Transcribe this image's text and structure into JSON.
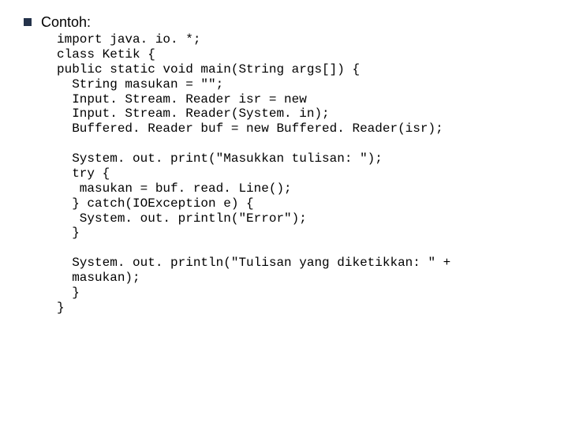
{
  "title": "Contoh:",
  "code": {
    "l1": "import java. io. *;",
    "l2": "class Ketik {",
    "l3": "public static void main(String args[]) {",
    "l4": "  String masukan = \"\";",
    "l5": "  Input. Stream. Reader isr = new",
    "l6": "  Input. Stream. Reader(System. in);",
    "l7": "  Buffered. Reader buf = new Buffered. Reader(isr);",
    "l8": "",
    "l9": "  System. out. print(\"Masukkan tulisan: \");",
    "l10": "  try {",
    "l11": "   masukan = buf. read. Line();",
    "l12": "  } catch(IOException e) {",
    "l13": "   System. out. println(\"Error\");",
    "l14": "  }",
    "l15": "",
    "l16": "  System. out. println(\"Tulisan yang diketikkan: \" +",
    "l17": "  masukan);",
    "l18": "  }",
    "l19": "}"
  }
}
